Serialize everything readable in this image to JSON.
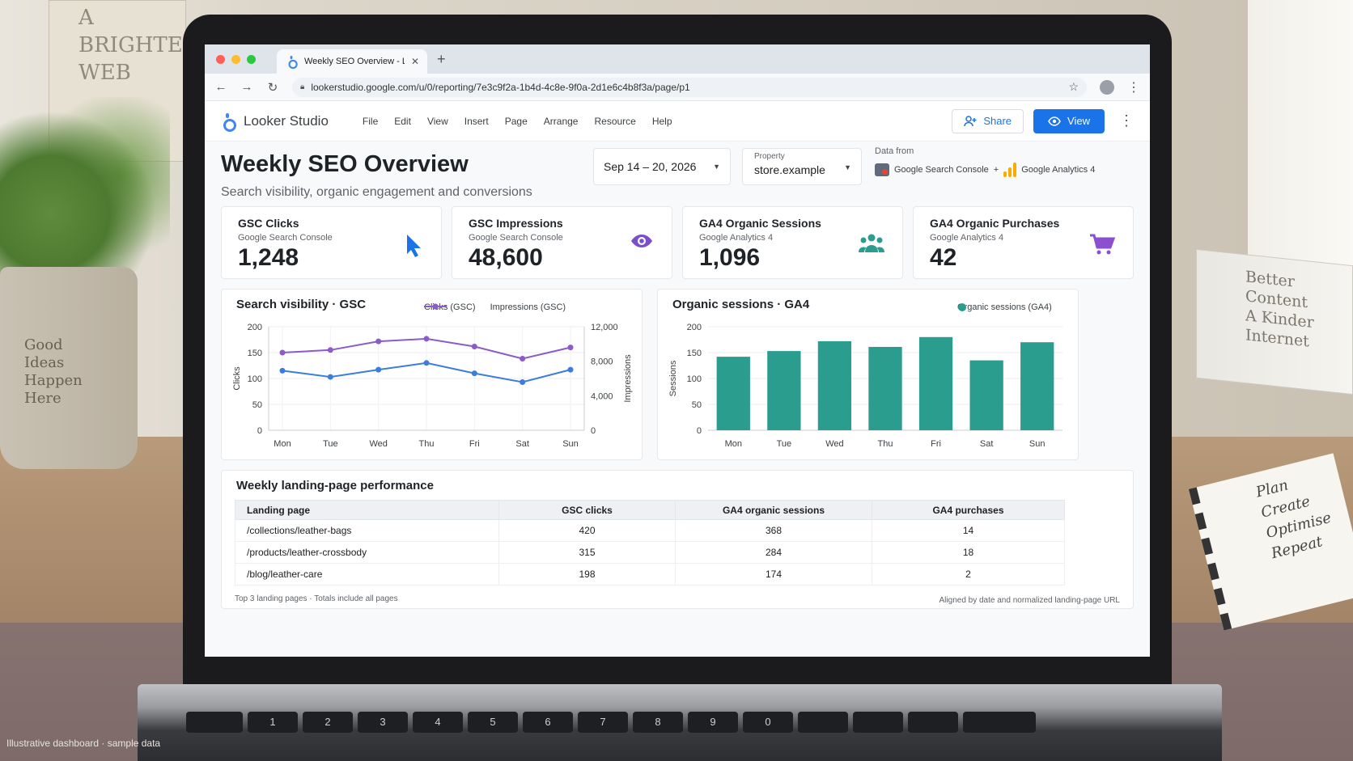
{
  "scene": {
    "poster_lines": [
      "A",
      "BRIGHTER",
      "WEB"
    ],
    "pot_lines": [
      "Good",
      "Ideas",
      "Happen",
      "Here"
    ],
    "box_lines": [
      "Better",
      "Content",
      "A Kinder",
      "Internet"
    ],
    "notebook_lines": [
      "Plan",
      "Create",
      "Optimise",
      "Repeat"
    ],
    "caption": "Illustrative dashboard · sample data",
    "keys": [
      "1",
      "2",
      "3",
      "4",
      "5",
      "6",
      "7",
      "8",
      "9",
      "0"
    ]
  },
  "browser": {
    "tab_title": "Weekly SEO Overview - Looker",
    "url": "lookerstudio.google.com/u/0/reporting/7e3c9f2a-1b4d-4c8e-9f0a-2d1e6c4b8f3a/page/p1",
    "dot_colors": [
      "#ff5f57",
      "#febc2e",
      "#28c840"
    ]
  },
  "app": {
    "name": "Looker Studio",
    "menu": [
      "File",
      "Edit",
      "View",
      "Insert",
      "Page",
      "Arrange",
      "Resource",
      "Help"
    ],
    "share_label": "Share",
    "view_label": "View",
    "accent": "#1a73e8"
  },
  "report": {
    "title": "Weekly SEO Overview",
    "subtitle": "Search visibility, organic engagement and conversions",
    "date_range": "Sep 14 – 20, 2026",
    "property_label": "Property",
    "property_value": "store.example",
    "data_from_label": "Data from",
    "source_1": "Google Search Console",
    "plus": "+",
    "source_2": "Google Analytics 4"
  },
  "kpis": [
    {
      "title": "GSC Clicks",
      "source": "Google Search Console",
      "value": "1,248",
      "icon": "cursor-icon",
      "color": "#1a73e8"
    },
    {
      "title": "GSC Impressions",
      "source": "Google Search Console",
      "value": "48,600",
      "icon": "eye-icon",
      "color": "#7b4fc9"
    },
    {
      "title": "GA4 Organic Sessions",
      "source": "Google Analytics 4",
      "value": "1,096",
      "icon": "people-icon",
      "color": "#2a9d8f"
    },
    {
      "title": "GA4 Organic Purchases",
      "source": "Google Analytics 4",
      "value": "42",
      "icon": "cart-icon",
      "color": "#8b4fd0"
    }
  ],
  "chart_data": [
    {
      "type": "line",
      "title": "Search visibility · GSC",
      "categories": [
        "Mon",
        "Tue",
        "Wed",
        "Thu",
        "Fri",
        "Sat",
        "Sun"
      ],
      "ylabel": "Clicks",
      "y2label": "Impressions",
      "ylim": [
        0,
        200
      ],
      "y2lim": [
        0,
        12000
      ],
      "yticks": [
        "0",
        "50",
        "100",
        "150",
        "200"
      ],
      "y2ticks": [
        "0",
        "4,000",
        "8,000",
        "12,000"
      ],
      "grid": true,
      "legend_position": "top-right",
      "series": [
        {
          "name": "Clicks (GSC)",
          "axis": "left",
          "color": "#3b7ddd",
          "values": [
            115,
            103,
            117,
            130,
            110,
            93,
            117
          ]
        },
        {
          "name": "Impressions (GSC)",
          "axis": "right",
          "color": "#8c5bc9",
          "values": [
            9000,
            9300,
            10300,
            10600,
            9700,
            8300,
            9600
          ]
        }
      ]
    },
    {
      "type": "bar",
      "title": "Organic sessions · GA4",
      "categories": [
        "Mon",
        "Tue",
        "Wed",
        "Thu",
        "Fri",
        "Sat",
        "Sun"
      ],
      "ylabel": "Sessions",
      "ylim": [
        0,
        200
      ],
      "yticks": [
        "0",
        "50",
        "100",
        "150",
        "200"
      ],
      "grid": true,
      "legend_position": "top-right",
      "series": [
        {
          "name": "Organic sessions (GA4)",
          "color": "#2a9d8f",
          "values": [
            142,
            153,
            172,
            161,
            180,
            135,
            170
          ]
        }
      ]
    }
  ],
  "table": {
    "title": "Weekly landing-page performance",
    "columns": [
      "Landing page",
      "GSC clicks",
      "GA4 organic sessions",
      "GA4 purchases"
    ],
    "rows": [
      [
        "/collections/leather-bags",
        "420",
        "368",
        "14"
      ],
      [
        "/products/leather-crossbody",
        "315",
        "284",
        "18"
      ],
      [
        "/blog/leather-care",
        "198",
        "174",
        "2"
      ]
    ],
    "footnote_left": "Top 3 landing pages · Totals include all pages",
    "footnote_right": "Aligned by date and normalized landing-page URL"
  }
}
